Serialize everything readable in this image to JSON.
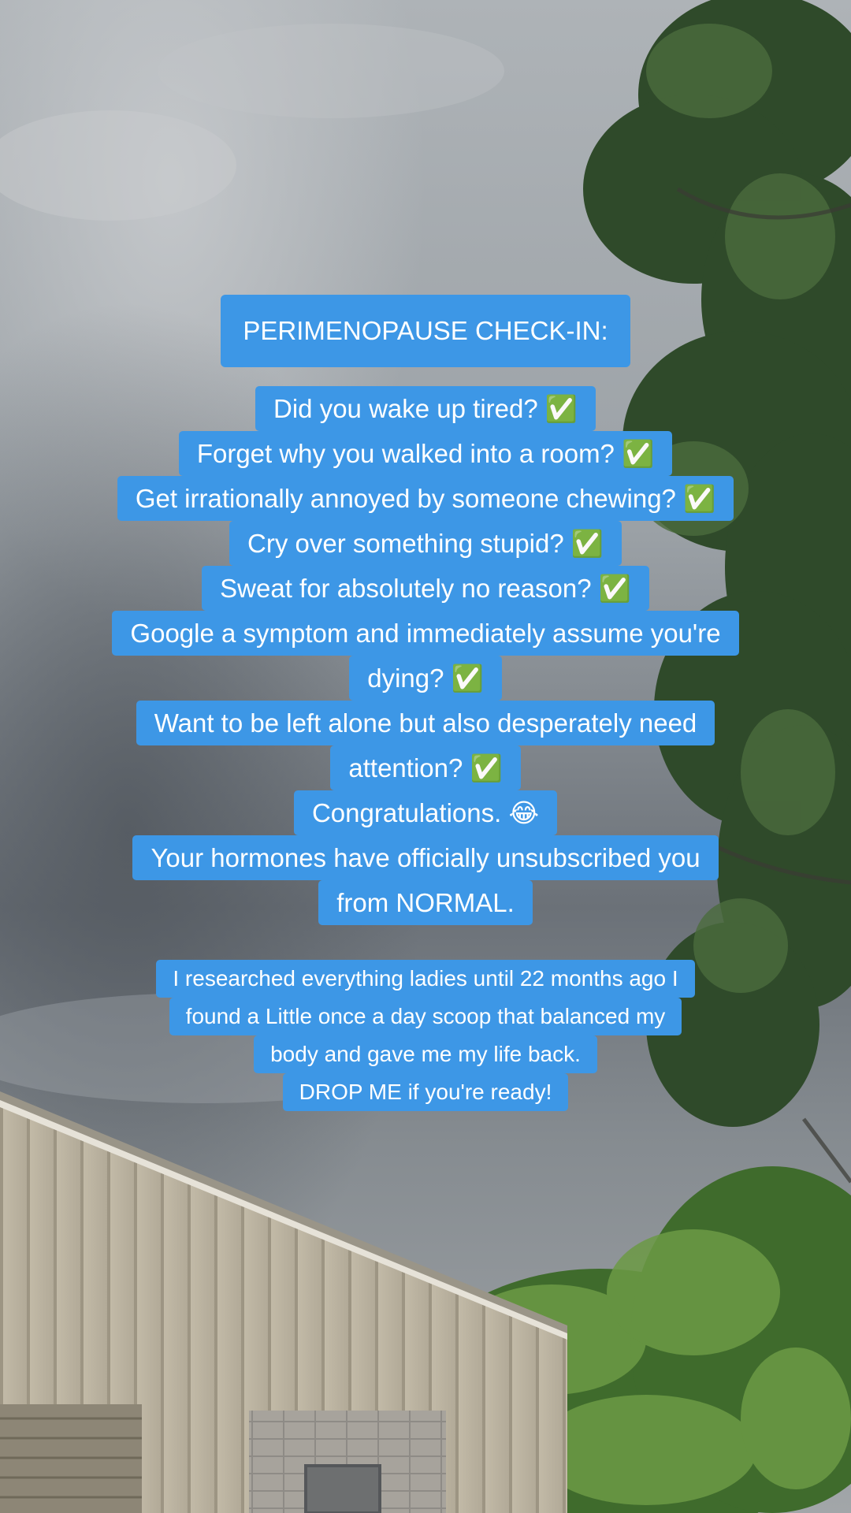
{
  "title": "PERIMENOPAUSE CHECK-IN:",
  "checklist_lines": [
    "Did you wake up tired? ✅",
    "Forget why you walked into a room? ✅",
    "Get irrationally annoyed by someone chewing? ✅",
    "Cry over something stupid? ✅",
    "Sweat for absolutely no reason? ✅",
    "Google a symptom and immediately assume you're",
    "dying? ✅",
    "Want to be left alone but also desperately need",
    "attention? ✅",
    "Congratulations. 😂",
    "Your hormones have officially unsubscribed you",
    "from NORMAL."
  ],
  "promo_lines": [
    "I researched everything ladies until 22 months ago I",
    "found a Little once a day scoop that balanced my",
    "body and gave me my life back.",
    "DROP ME if you're ready!"
  ],
  "colors": {
    "caption_background": "#3d97e6",
    "caption_text": "#ffffff"
  }
}
